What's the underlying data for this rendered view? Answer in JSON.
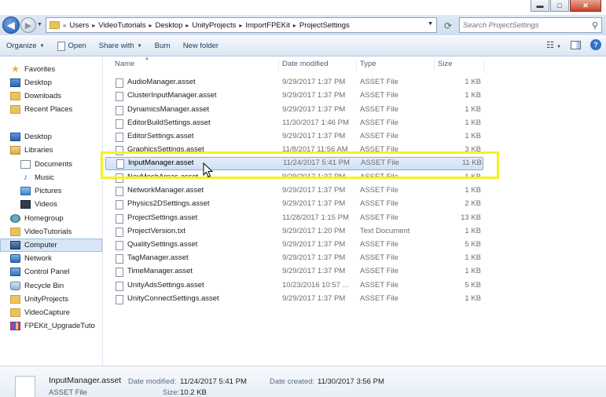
{
  "window": {
    "minimize": "▬",
    "maximize": "□",
    "close": "✕"
  },
  "address_bar": {
    "overflow": "«",
    "crumbs": [
      "Users",
      "VideoTutorials",
      "Desktop",
      "UnityProjects",
      "ImportFPEKit",
      "ProjectSettings"
    ],
    "search_placeholder": "Search ProjectSettings"
  },
  "toolbar": {
    "organize": "Organize",
    "open": "Open",
    "share_with": "Share with",
    "burn": "Burn",
    "new_folder": "New folder"
  },
  "nav": {
    "favorites": "Favorites",
    "desktop_fav": "Desktop",
    "downloads": "Downloads",
    "recent_places": "Recent Places",
    "desktop": "Desktop",
    "libraries": "Libraries",
    "documents": "Documents",
    "music": "Music",
    "pictures": "Pictures",
    "videos": "Videos",
    "homegroup": "Homegroup",
    "videotutorials": "VideoTutorials",
    "computer": "Computer",
    "network": "Network",
    "control_panel": "Control Panel",
    "recycle_bin": "Recycle Bin",
    "unityprojects": "UnityProjects",
    "videocapture": "VideoCapture",
    "fpekit": "FPEKit_UpgradeTuto"
  },
  "columns": {
    "name": "Name",
    "date": "Date modified",
    "type": "Type",
    "size": "Size"
  },
  "files": [
    {
      "name": "AudioManager.asset",
      "date": "9/29/2017 1:37 PM",
      "type": "ASSET File",
      "size": "1 KB"
    },
    {
      "name": "ClusterInputManager.asset",
      "date": "9/29/2017 1:37 PM",
      "type": "ASSET File",
      "size": "1 KB"
    },
    {
      "name": "DynamicsManager.asset",
      "date": "9/29/2017 1:37 PM",
      "type": "ASSET File",
      "size": "1 KB"
    },
    {
      "name": "EditorBuildSettings.asset",
      "date": "11/30/2017 1:46 PM",
      "type": "ASSET File",
      "size": "1 KB"
    },
    {
      "name": "EditorSettings.asset",
      "date": "9/29/2017 1:37 PM",
      "type": "ASSET File",
      "size": "1 KB"
    },
    {
      "name": "GraphicsSettings.asset",
      "date": "11/8/2017 11:56 AM",
      "type": "ASSET File",
      "size": "3 KB"
    },
    {
      "name": "InputManager.asset",
      "date": "11/24/2017 5:41 PM",
      "type": "ASSET File",
      "size": "11 KB"
    },
    {
      "name": "NavMeshAreas.asset",
      "date": "9/29/2017 1:37 PM",
      "type": "ASSET File",
      "size": "1 KB"
    },
    {
      "name": "NetworkManager.asset",
      "date": "9/29/2017 1:37 PM",
      "type": "ASSET File",
      "size": "1 KB"
    },
    {
      "name": "Physics2DSettings.asset",
      "date": "9/29/2017 1:37 PM",
      "type": "ASSET File",
      "size": "2 KB"
    },
    {
      "name": "ProjectSettings.asset",
      "date": "11/28/2017 1:15 PM",
      "type": "ASSET File",
      "size": "13 KB"
    },
    {
      "name": "ProjectVersion.txt",
      "date": "9/29/2017 1:20 PM",
      "type": "Text Document",
      "size": "1 KB"
    },
    {
      "name": "QualitySettings.asset",
      "date": "9/29/2017 1:37 PM",
      "type": "ASSET File",
      "size": "5 KB"
    },
    {
      "name": "TagManager.asset",
      "date": "9/29/2017 1:37 PM",
      "type": "ASSET File",
      "size": "1 KB"
    },
    {
      "name": "TimeManager.asset",
      "date": "9/29/2017 1:37 PM",
      "type": "ASSET File",
      "size": "1 KB"
    },
    {
      "name": "UnityAdsSettings.asset",
      "date": "10/23/2016 10:57 ...",
      "type": "ASSET File",
      "size": "5 KB"
    },
    {
      "name": "UnityConnectSettings.asset",
      "date": "9/29/2017 1:37 PM",
      "type": "ASSET File",
      "size": "1 KB"
    }
  ],
  "details": {
    "name": "InputManager.asset",
    "type": "ASSET File",
    "date_modified_label": "Date modified:",
    "date_modified": "11/24/2017 5:41 PM",
    "date_created_label": "Date created:",
    "date_created": "11/30/2017 3:56 PM",
    "size_label": "Size:",
    "size": "10.2 KB"
  },
  "colors": {
    "highlight": "#f4f125",
    "selection": "#cfe0f5",
    "accent": "#2f72c6"
  }
}
